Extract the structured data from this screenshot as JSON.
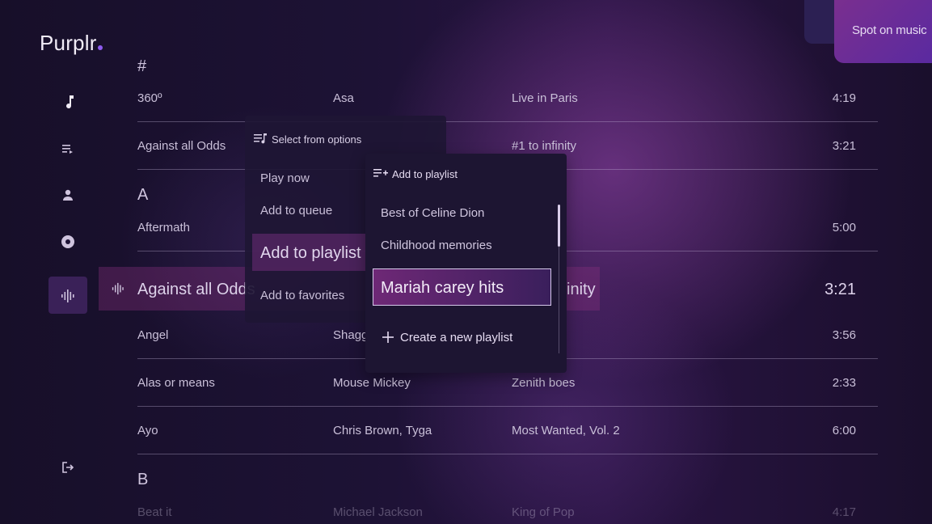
{
  "app": {
    "logo": "Purplr"
  },
  "promo": {
    "label": "Spot on music"
  },
  "sidebar": {
    "icons": [
      "music-note-icon",
      "queue-icon",
      "user-icon",
      "album-icon",
      "equalizer-icon",
      "logout-icon"
    ]
  },
  "tracks": {
    "sections": [
      "#",
      "A",
      "B"
    ],
    "rows": [
      {
        "title": "360º",
        "artist": "Asa",
        "album": "Live in Paris",
        "duration": "4:19"
      },
      {
        "title": "Against all Odds",
        "artist": "",
        "album": "#1 to infinity",
        "duration": "3:21"
      },
      {
        "title": "Aftermath",
        "artist": "",
        "album": "",
        "duration": "5:00"
      },
      {
        "title": "Against all Odds",
        "artist": "",
        "album": "inity",
        "duration": "3:21"
      },
      {
        "title": "Angel",
        "artist": "Shagg",
        "album": "",
        "duration": "3:56"
      },
      {
        "title": "Alas or means",
        "artist": "Mouse Mickey",
        "album": "Zenith boes",
        "duration": "2:33"
      },
      {
        "title": "Ayo",
        "artist": "Chris Brown, Tyga",
        "album": "Most Wanted, Vol. 2",
        "duration": "6:00"
      },
      {
        "title": "Beat it",
        "artist": "Michael Jackson",
        "album": "King of Pop",
        "duration": "4:17"
      }
    ]
  },
  "menu": {
    "title": "Select from options",
    "items": [
      "Play now",
      "Add to queue",
      "Add to playlist",
      "Add to favorites"
    ]
  },
  "playlist_menu": {
    "title": "Add to playlist",
    "items": [
      "Best of Celine Dion",
      "Childhood memories",
      "Mariah carey hits"
    ],
    "create_label": "Create a new playlist"
  }
}
